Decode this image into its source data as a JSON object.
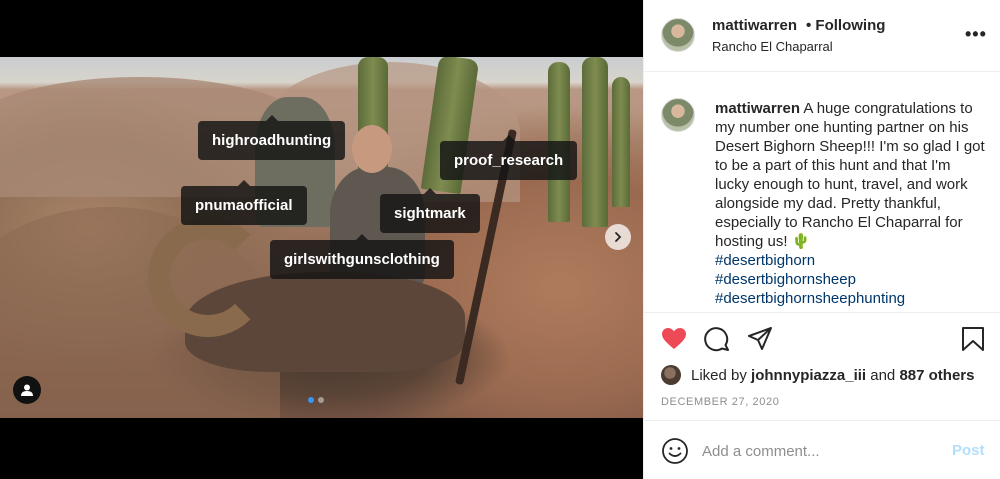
{
  "post": {
    "username": "mattiwarren",
    "follow_status": "• Following",
    "location": "Rancho El Chaparral",
    "more_icon": "more-options-icon",
    "caption_user": "mattiwarren",
    "caption_text": "A huge congratulations to my number one hunting partner on his Desert Bighorn Sheep!!! I'm so glad I got to be a part of this hunt and that I'm lucky enough to hunt, travel, and work alongside my dad. Pretty thankful, especially to Rancho El Chaparral for hosting us! 🌵",
    "hashtags": [
      "#desertbighorn",
      "#desertbighornsheep",
      "#desertbighornsheephunting"
    ],
    "likes_prefix": "Liked by ",
    "likes_user": "johnnypiazza_iii",
    "likes_mid": " and ",
    "likes_count": "887 others",
    "date": "DECEMBER 27, 2020",
    "comment_placeholder": "Add a comment...",
    "post_label": "Post",
    "liked": true,
    "colors": {
      "like_red": "#ed4956",
      "hashtag": "#00376b",
      "post_disabled": "#b2dffc",
      "carousel_active": "#3897f0"
    }
  },
  "media": {
    "tags": [
      "highroadhunting",
      "proof_research",
      "pnumaofficial",
      "sightmark",
      "girlswithgunsclothing"
    ],
    "carousel": {
      "current": 1,
      "total": 2
    },
    "icons": {
      "next": "chevron-right-icon",
      "user_tags": "user-tag-icon"
    }
  }
}
